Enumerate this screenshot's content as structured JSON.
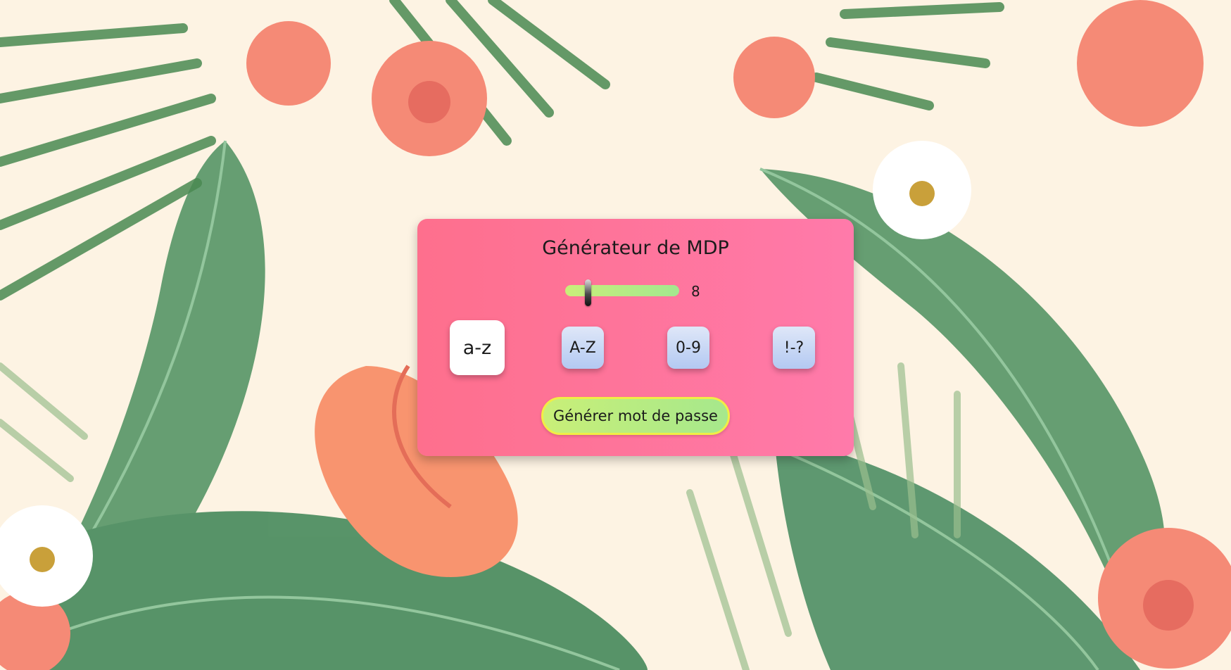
{
  "app": {
    "title": "Générateur de MDP"
  },
  "length": {
    "value": "8",
    "fraction": 0.18
  },
  "options": [
    {
      "label": "a-z",
      "active": true
    },
    {
      "label": "A-Z",
      "active": false
    },
    {
      "label": "0-9",
      "active": false
    },
    {
      "label": "!-?",
      "active": false
    }
  ],
  "generate_button": {
    "label": "Générer mot de passe"
  },
  "colors": {
    "card": "#fe6f8d",
    "slider_track": "#b5eb85",
    "option_button": "#c9d8f5",
    "option_active": "#ffffff",
    "generate_border": "#f1ee45",
    "generate_fill": "#b8ec82"
  }
}
